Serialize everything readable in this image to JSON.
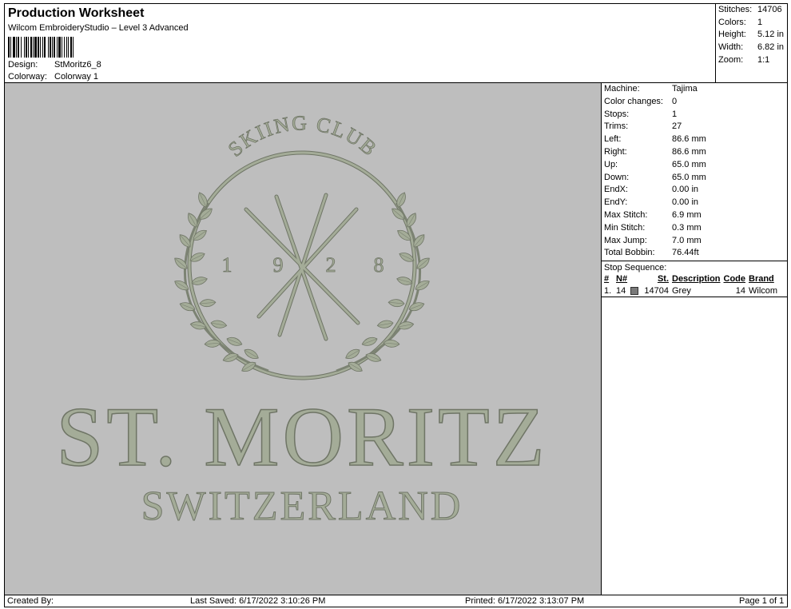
{
  "header": {
    "title": "Production Worksheet",
    "subtitle": "Wilcom EmbroideryStudio – Level 3 Advanced",
    "design_label": "Design:",
    "design_value": "StMoritz6_8",
    "colorway_label": "Colorway:",
    "colorway_value": "Colorway 1"
  },
  "stats": [
    {
      "label": "Stitches:",
      "value": "14706"
    },
    {
      "label": "Colors:",
      "value": "1"
    },
    {
      "label": "Height:",
      "value": "5.12 in"
    },
    {
      "label": "Width:",
      "value": "6.82 in"
    },
    {
      "label": "Zoom:",
      "value": "1:1"
    }
  ],
  "design": {
    "arc_text": "SKIING CLUB",
    "year_digits": [
      "1",
      "9",
      "2",
      "8"
    ],
    "main_text": "ST. MORITZ",
    "sub_text": "SWITZERLAND",
    "thread_color": "#a4ac98",
    "background_color": "#bebebe"
  },
  "machine_info": [
    {
      "label": "Machine:",
      "value": "Tajima"
    },
    {
      "label": "Color changes:",
      "value": "0"
    },
    {
      "label": "Stops:",
      "value": "1"
    },
    {
      "label": "Trims:",
      "value": "27"
    },
    {
      "label": "Left:",
      "value": "86.6 mm"
    },
    {
      "label": "Right:",
      "value": "86.6 mm"
    },
    {
      "label": "Up:",
      "value": "65.0 mm"
    },
    {
      "label": "Down:",
      "value": "65.0 mm"
    },
    {
      "label": "EndX:",
      "value": "0.00 in"
    },
    {
      "label": "EndY:",
      "value": "0.00 in"
    },
    {
      "label": "Max Stitch:",
      "value": "6.9 mm"
    },
    {
      "label": "Min Stitch:",
      "value": "0.3 mm"
    },
    {
      "label": "Max Jump:",
      "value": "7.0 mm"
    },
    {
      "label": "Total Bobbin:",
      "value": "76.44ft"
    }
  ],
  "stop_sequence": {
    "title": "Stop Sequence:",
    "columns": {
      "num": "#",
      "n": "N#",
      "st": "St.",
      "description": "Description",
      "code": "Code",
      "brand": "Brand"
    },
    "rows": [
      {
        "num": "1.",
        "n": "14",
        "swatch_color": "#7a7a7a",
        "st": "14704",
        "description": "Grey",
        "code": "14",
        "brand": "Wilcom"
      }
    ]
  },
  "footer": {
    "created_by": "Created By:",
    "last_saved": "Last Saved: 6/17/2022 3:10:26 PM",
    "printed": "Printed: 6/17/2022 3:13:07 PM",
    "page": "Page 1 of 1"
  }
}
